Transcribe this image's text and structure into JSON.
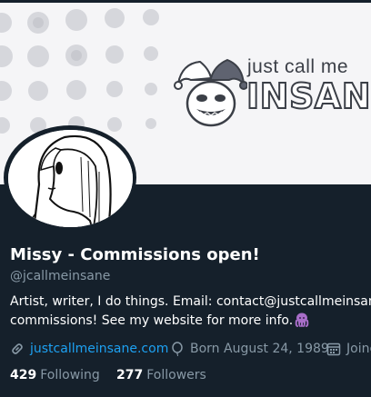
{
  "banner": {
    "logo_line1": "just call me",
    "logo_line2": "INSANE"
  },
  "profile": {
    "name": "Missy - Commissions open!",
    "handle": "@jcallmeinsane",
    "bio_line1": "Artist, writer, I do things. Email: contact@justcallmeinsane.com",
    "bio_line2": "commissions! See my website for more info."
  },
  "meta": {
    "website": "justcallmeinsane.com",
    "birthday": "Born August 24, 1989",
    "joined": "Joined"
  },
  "stats": {
    "following_count": "429",
    "following_label": "Following",
    "followers_count": "277",
    "followers_label": "Followers"
  },
  "colors": {
    "background": "#15202b",
    "link": "#1da1f2",
    "secondary_text": "#8899a6",
    "octopus": "#a86ec9"
  }
}
